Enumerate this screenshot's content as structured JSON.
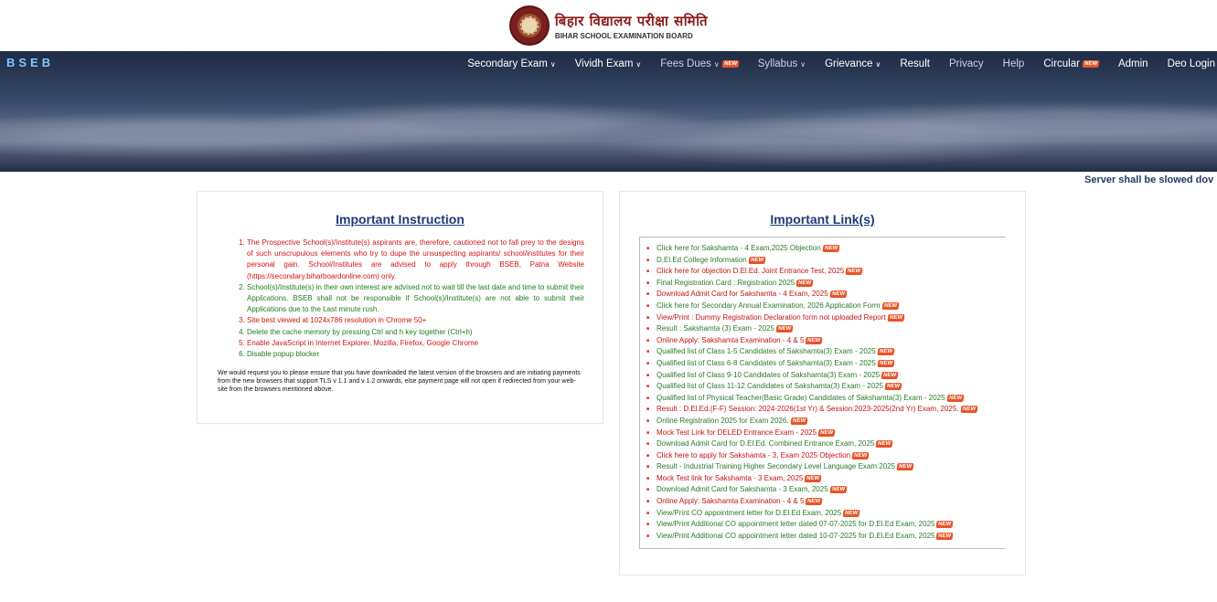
{
  "header": {
    "title_hindi": "बिहार विद्यालय परीक्षा समिति",
    "title_english": "BIHAR SCHOOL EXAMINATION BOARD"
  },
  "brand": "BSEB",
  "nav": [
    {
      "label": "Secondary Exam",
      "dropdown": true,
      "new": false,
      "dim": false
    },
    {
      "label": "Vividh Exam",
      "dropdown": true,
      "new": false,
      "dim": false
    },
    {
      "label": "Fees Dues",
      "dropdown": true,
      "new": true,
      "dim": true
    },
    {
      "label": "Syllabus",
      "dropdown": true,
      "new": false,
      "dim": true
    },
    {
      "label": "Grievance",
      "dropdown": true,
      "new": false,
      "dim": false
    },
    {
      "label": "Result",
      "dropdown": false,
      "new": false,
      "dim": false
    },
    {
      "label": "Privacy",
      "dropdown": false,
      "new": false,
      "dim": true
    },
    {
      "label": "Help",
      "dropdown": false,
      "new": false,
      "dim": true
    },
    {
      "label": "Circular",
      "dropdown": false,
      "new": true,
      "dim": false
    },
    {
      "label": "Admin",
      "dropdown": false,
      "new": false,
      "dim": false
    },
    {
      "label": "Deo Login",
      "dropdown": false,
      "new": false,
      "dim": false
    }
  ],
  "new_badge_text": "NEW",
  "marquee": "Server shall be slowed dov",
  "instructions": {
    "title": "Important Instruction",
    "items": [
      {
        "text": "The Prospective School(s)/Institute(s) aspirants are, therefore, cautioned not to fall prey to the designs of such unscrupulous elements who try to dupe the unsuspecting aspirants/ school/institutes for their personal gain. School/Institutes are advised to apply through BSEB, Patna Website (https://secondary.biharboardonline.com) only.",
        "color": "red"
      },
      {
        "text": "School(s)/Institute(s) in their own interest are advised not to wait till the last date and time to submit their Applications. BSEB shall not be responsible if School(s)/Institute(s) are not able to submit their Applications due to the Last minute rush.",
        "color": "green"
      },
      {
        "text": "Site best viewed at 1024x786 resolution in Chrome 50+",
        "color": "red"
      },
      {
        "text": "Delete the cache memory by pressing Ctrl and h key together (Ctrl+h)",
        "color": "green"
      },
      {
        "text": "Enable JavaScript in Internet Explorer, Mozilla, Firefox, Google Chrome",
        "color": "red"
      },
      {
        "text": "Disable popup blocker",
        "color": "green"
      }
    ],
    "note": "We would request you to please ensure that you have downloaded the latest version of the browsers and are initiating payments from the new browsers that support TLS v 1.1 and v 1.2 onwards, else payment page will not open if redirected from your web-site from the browsers mentioned above."
  },
  "links": {
    "title": "Important Link(s)",
    "items": [
      {
        "text": "Click here for Sakshamta - 4 Exam,2025 Objection",
        "color": "green"
      },
      {
        "text": "D.El.Ed College Information",
        "color": "green"
      },
      {
        "text": "Click here for objection D.El.Ed. Joint Entrance Test, 2025",
        "color": "red"
      },
      {
        "text": "Final Registration Card : Registration 2025",
        "color": "green"
      },
      {
        "text": "Download Admit Card for Sakshamta - 4 Exam, 2025",
        "color": "red"
      },
      {
        "text": "Click here for Secondary Annual Examination, 2026 Application Form",
        "color": "green"
      },
      {
        "text": "View/Print : Dummy Registration Declaration form not uploaded Report",
        "color": "red"
      },
      {
        "text": "Result : Sakshamta (3) Exam - 2025",
        "color": "green"
      },
      {
        "text": "Online Apply: Sakshamta Examination - 4 & 5",
        "color": "red"
      },
      {
        "text": "Qualified list of Class 1-5 Candidates of Sakshamta(3) Exam - 2025",
        "color": "green"
      },
      {
        "text": "Qualified list of Class 6-8 Candidates of Sakshamta(3) Exam - 2025",
        "color": "green"
      },
      {
        "text": "Qualified list of Class 9-10 Candidates of Sakshamta(3) Exam - 2025",
        "color": "green"
      },
      {
        "text": "Qualified list of Class 11-12 Candidates of Sakshamta(3) Exam - 2025",
        "color": "green"
      },
      {
        "text": "Qualified list of Physical Teacher(Basic Grade) Candidates of Sakshamta(3) Exam - 2025",
        "color": "green"
      },
      {
        "text": "Result : D.El.Ed.(F-F) Session: 2024-2026(1st Yr) & Session:2023-2025(2nd Yr) Exam, 2025.",
        "color": "red"
      },
      {
        "text": "Online Registration 2025 for Exam 2026.",
        "color": "green"
      },
      {
        "text": "Mock Test Link for DELED Entrance Exam - 2025",
        "color": "red"
      },
      {
        "text": "Download Admit Card for D.El.Ed. Combined Entrance Exam, 2025",
        "color": "green"
      },
      {
        "text": "Click here to apply for Sakshamta - 3, Exam 2025 Objection",
        "color": "red"
      },
      {
        "text": "Result - Industrial Training Higher Secondary Level Language Exam 2025",
        "color": "green"
      },
      {
        "text": "Mock Test link for Sakshamta - 3 Exam, 2025",
        "color": "red"
      },
      {
        "text": "Download Admit Card for Sakshamta - 3 Exam, 2025",
        "color": "green"
      },
      {
        "text": "Online Apply: Sakshamta Examination - 4 & 5",
        "color": "red"
      },
      {
        "text": "View/Print CO appointment letter for D.El.Ed Exam, 2025",
        "color": "green"
      },
      {
        "text": "View/Print Additional CO appointment letter dated 07-07-2025 for D.El.Ed Exam, 2025",
        "color": "green"
      },
      {
        "text": "View/Print Additional CO appointment letter dated 10-07-2025 for D.El.Ed Exam, 2025",
        "color": "green"
      }
    ]
  }
}
